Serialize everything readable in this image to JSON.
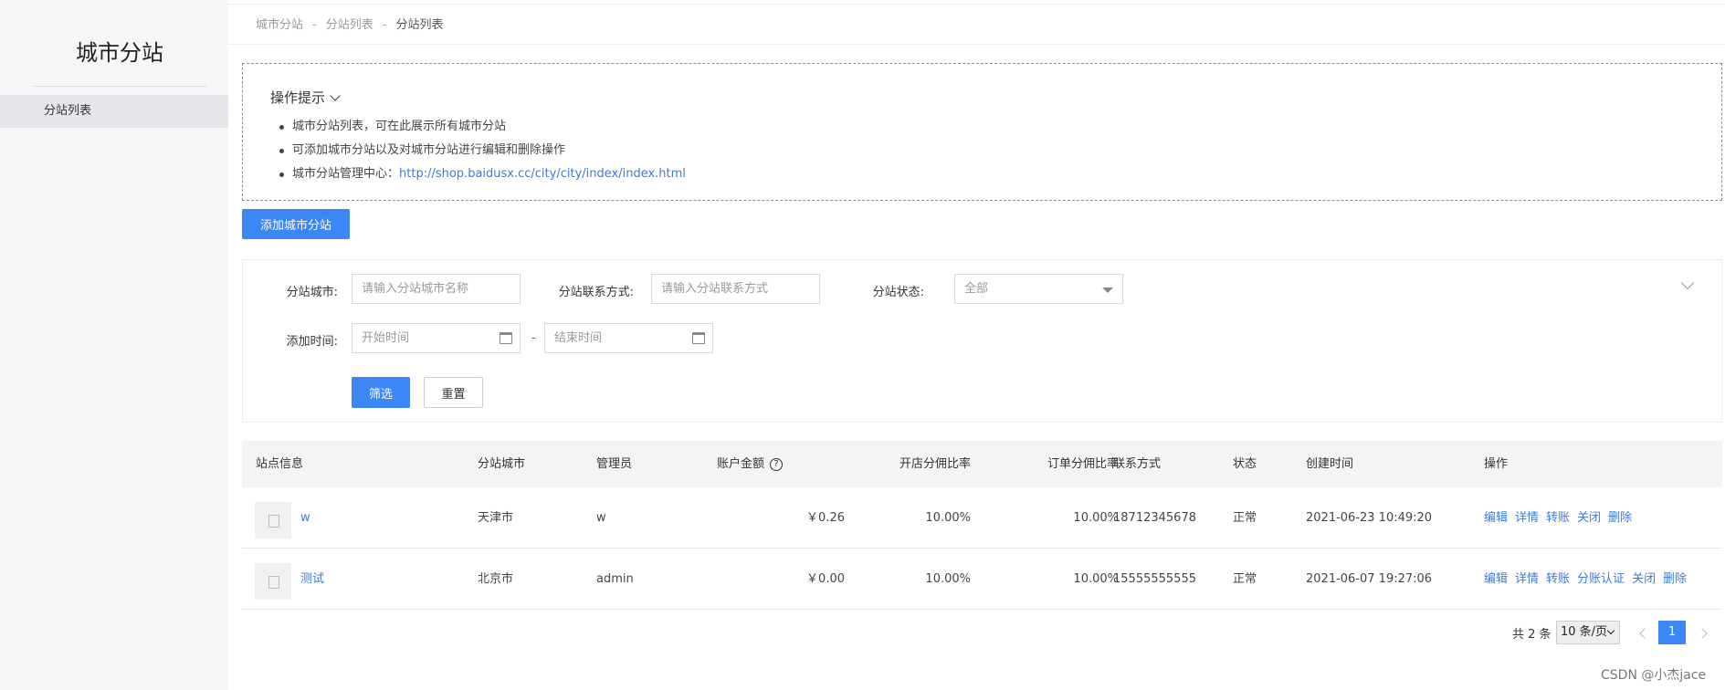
{
  "sidebar": {
    "title": "城市分站",
    "items": [
      {
        "label": "分站列表"
      }
    ]
  },
  "breadcrumb": {
    "items": [
      "城市分站",
      "分站列表",
      "分站列表"
    ],
    "separator": "-"
  },
  "tips": {
    "title": "操作提示",
    "items": [
      "城市分站列表，可在此展示所有城市分站",
      "可添加城市分站以及对城市分站进行编辑和删除操作",
      "城市分站管理中心："
    ],
    "link": "http://shop.baidusx.cc/city/city/index/index.html"
  },
  "add_button": "添加城市分站",
  "filter": {
    "city_label": "分站城市:",
    "city_placeholder": "请输入分站城市名称",
    "contact_label": "分站联系方式:",
    "contact_placeholder": "请输入分站联系方式",
    "status_label": "分站状态:",
    "status_value": "全部",
    "time_label": "添加时间:",
    "start_placeholder": "开始时间",
    "time_sep": "-",
    "end_placeholder": "结束时间",
    "filter_button": "筛选",
    "reset_button": "重置"
  },
  "table": {
    "headers": {
      "site": "站点信息",
      "city": "分站城市",
      "admin": "管理员",
      "balance": "账户金额",
      "help": "?",
      "open_rate": "开店分佣比率",
      "order_rate": "订单分佣比率",
      "contact": "联系方式",
      "status": "状态",
      "created": "创建时间",
      "ops": "操作"
    },
    "rows": [
      {
        "name": "w",
        "city": "天津市",
        "admin": "w",
        "balance": "￥0.26",
        "open_rate": "10.00%",
        "order_rate": "10.00%",
        "contact": "18712345678",
        "status": "正常",
        "created": "2021-06-23 10:49:20",
        "ops": [
          "编辑",
          "详情",
          "转账",
          "关闭",
          "删除"
        ]
      },
      {
        "name": "测试",
        "city": "北京市",
        "admin": "admin",
        "balance": "￥0.00",
        "open_rate": "10.00%",
        "order_rate": "10.00%",
        "contact": "15555555555",
        "status": "正常",
        "created": "2021-06-07 19:27:06",
        "ops": [
          "编辑",
          "详情",
          "转账",
          "分账认证",
          "关闭",
          "删除"
        ]
      }
    ]
  },
  "pagination": {
    "total": "共 2 条",
    "page_size": "10 条/页",
    "current_page": "1"
  },
  "watermark": "CSDN @小杰jace",
  "colors": {
    "primary": "#3c87f6",
    "link": "#3a7be0",
    "sidebar_bg": "#f5f6f7"
  }
}
